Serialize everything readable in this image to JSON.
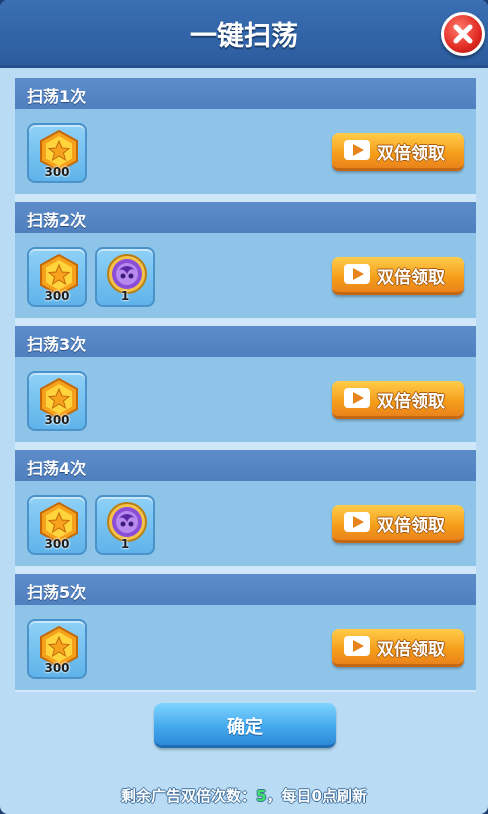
{
  "dialog": {
    "title": "一键扫荡",
    "close_icon": "close-icon"
  },
  "colors": {
    "header": "#2b5c9e",
    "panel": "#b9dcf4",
    "row_header": "#4f7fbe",
    "ad_button": "#f59d1a",
    "confirm_button": "#41a6ec",
    "count_highlight": "#3ee36a"
  },
  "sweeps": [
    {
      "label": "扫荡1次",
      "items": [
        {
          "icon": "gold-coin-icon",
          "qty": "300"
        }
      ],
      "button": "双倍领取"
    },
    {
      "label": "扫荡2次",
      "items": [
        {
          "icon": "gold-coin-icon",
          "qty": "300"
        },
        {
          "icon": "purple-orb-icon",
          "qty": "1"
        }
      ],
      "button": "双倍领取"
    },
    {
      "label": "扫荡3次",
      "items": [
        {
          "icon": "gold-coin-icon",
          "qty": "300"
        }
      ],
      "button": "双倍领取"
    },
    {
      "label": "扫荡4次",
      "items": [
        {
          "icon": "gold-coin-icon",
          "qty": "300"
        },
        {
          "icon": "purple-orb-icon",
          "qty": "1"
        }
      ],
      "button": "双倍领取"
    },
    {
      "label": "扫荡5次",
      "items": [
        {
          "icon": "gold-coin-icon",
          "qty": "300"
        }
      ],
      "button": "双倍领取"
    }
  ],
  "confirm_label": "确定",
  "footer": {
    "prefix": "剩余广告双倍次数：",
    "count": "5",
    "suffix": "，每日0点刷新"
  }
}
